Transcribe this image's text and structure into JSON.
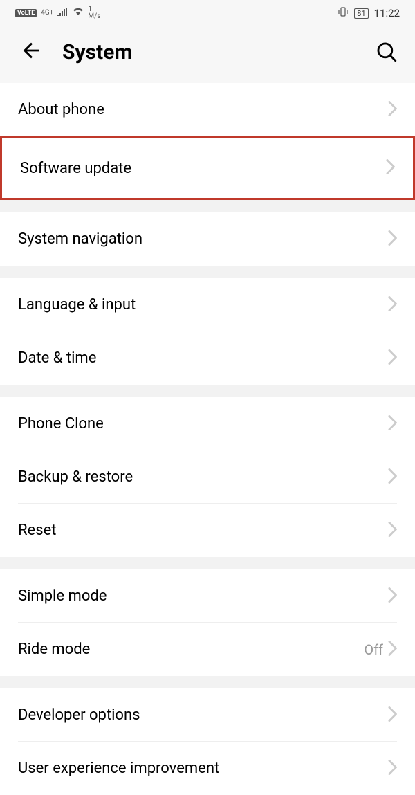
{
  "status": {
    "volte": "VoLTE",
    "network": "4G+",
    "speed_num": "1",
    "speed_unit": "M/s",
    "battery": "81",
    "time": "11:22"
  },
  "header": {
    "title": "System"
  },
  "groups": [
    {
      "items": [
        {
          "label": "About phone",
          "value": "",
          "highlighted": false,
          "divider": false
        },
        {
          "label": "Software update",
          "value": "",
          "highlighted": true,
          "divider": false
        }
      ]
    },
    {
      "items": [
        {
          "label": "System navigation",
          "value": "",
          "highlighted": false,
          "divider": false
        }
      ]
    },
    {
      "items": [
        {
          "label": "Language & input",
          "value": "",
          "highlighted": false,
          "divider": true
        },
        {
          "label": "Date & time",
          "value": "",
          "highlighted": false,
          "divider": false
        }
      ]
    },
    {
      "items": [
        {
          "label": "Phone Clone",
          "value": "",
          "highlighted": false,
          "divider": true
        },
        {
          "label": "Backup & restore",
          "value": "",
          "highlighted": false,
          "divider": true
        },
        {
          "label": "Reset",
          "value": "",
          "highlighted": false,
          "divider": false
        }
      ]
    },
    {
      "items": [
        {
          "label": "Simple mode",
          "value": "",
          "highlighted": false,
          "divider": true
        },
        {
          "label": "Ride mode",
          "value": "Off",
          "highlighted": false,
          "divider": false
        }
      ]
    },
    {
      "items": [
        {
          "label": "Developer options",
          "value": "",
          "highlighted": false,
          "divider": true
        },
        {
          "label": "User experience improvement",
          "value": "",
          "highlighted": false,
          "divider": false
        }
      ]
    }
  ]
}
